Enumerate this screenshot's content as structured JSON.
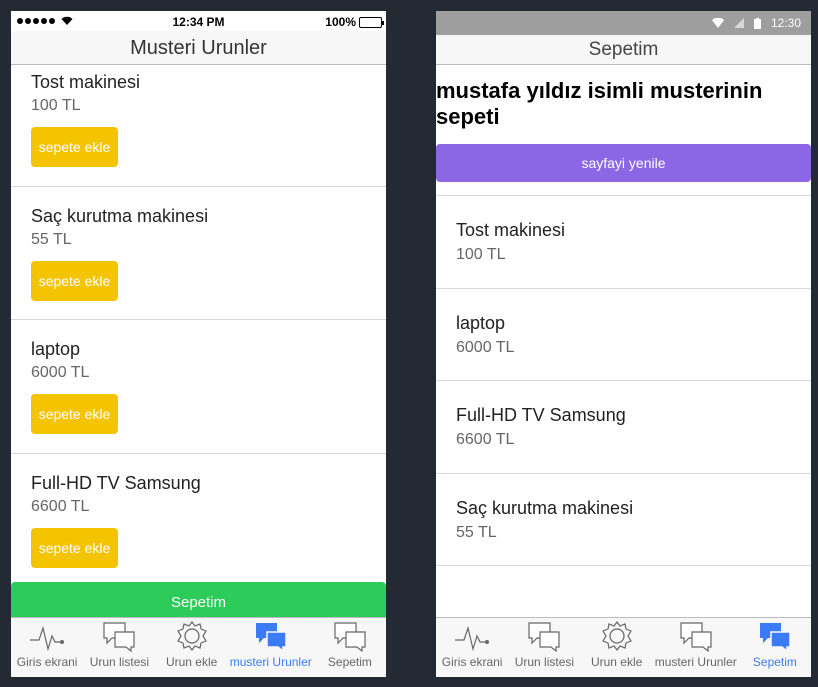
{
  "ios": {
    "status": {
      "carrier_icon": "signal-dots",
      "time": "12:34 PM",
      "battery": "100%"
    },
    "header_title": "Musteri Urunler",
    "products": [
      {
        "name": "Tost makinesi",
        "price": "100 TL",
        "button": "sepete ekle"
      },
      {
        "name": "Saç kurutma makinesi",
        "price": "55 TL",
        "button": "sepete ekle"
      },
      {
        "name": "laptop",
        "price": "6000 TL",
        "button": "sepete ekle"
      },
      {
        "name": "Full-HD TV Samsung",
        "price": "6600 TL",
        "button": "sepete ekle"
      }
    ],
    "cart_button": "Sepetim",
    "tabs": [
      {
        "label": "Giris ekrani",
        "icon": "pulse-icon"
      },
      {
        "label": "Urun listesi",
        "icon": "chat-icon"
      },
      {
        "label": "Urun ekle",
        "icon": "gear-icon"
      },
      {
        "label": "musteri Urunler",
        "icon": "chat-icon",
        "active": true
      },
      {
        "label": "Sepetim",
        "icon": "chat-icon"
      }
    ]
  },
  "android": {
    "status": {
      "time": "12:30"
    },
    "header_title": "Sepetim",
    "page_title": "mustafa yıldız isimli musterinin sepeti",
    "refresh_button": "sayfayi yenile",
    "cart_items": [
      {
        "name": "Tost makinesi",
        "price": "100 TL"
      },
      {
        "name": "laptop",
        "price": "6000 TL"
      },
      {
        "name": "Full-HD TV Samsung",
        "price": "6600 TL"
      },
      {
        "name": "Saç kurutma makinesi",
        "price": "55 TL"
      }
    ],
    "tabs": [
      {
        "label": "Giris ekrani",
        "icon": "pulse-icon"
      },
      {
        "label": "Urun listesi",
        "icon": "chat-icon"
      },
      {
        "label": "Urun ekle",
        "icon": "gear-icon"
      },
      {
        "label": "musteri Urunler",
        "icon": "chat-icon"
      },
      {
        "label": "Sepetim",
        "icon": "chat-icon",
        "active": true
      }
    ]
  },
  "colors": {
    "add_button": "#f5c400",
    "cart_button": "#2dcb59",
    "refresh_button": "#8b67e6",
    "active_tab": "#3b7bf5"
  }
}
